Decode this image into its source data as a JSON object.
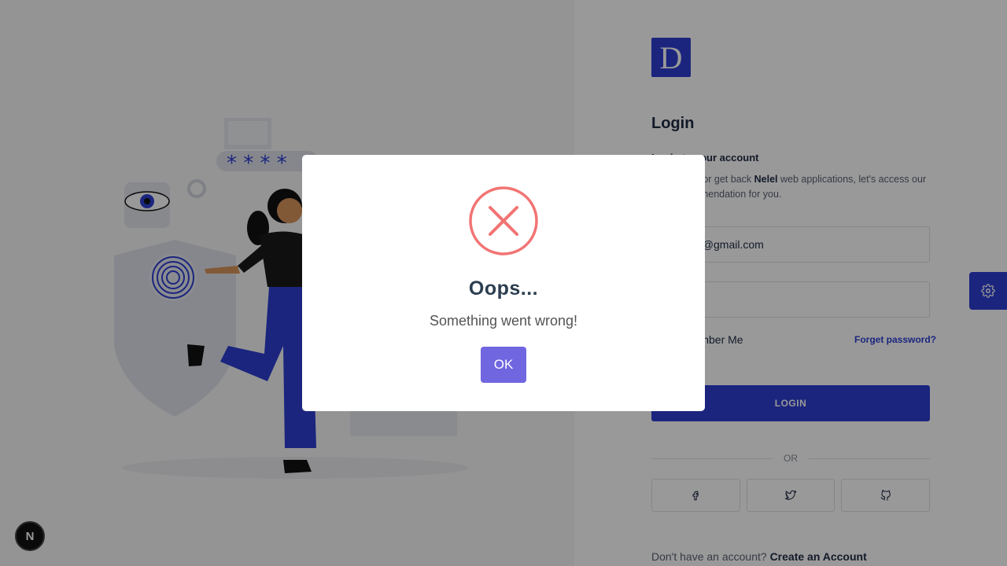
{
  "brand": {
    "logo_letter": "D",
    "accent": "#2d3fd3"
  },
  "login": {
    "title": "Login",
    "subtitle": "Login to your account",
    "desc_prefix": "Thank you for get back ",
    "desc_brand": "Nelel",
    "desc_suffix": " web applications, let's access our best recommendation for you.",
    "email_value": "kbxr203@gmail.com",
    "password_value": "",
    "remember_label": "Remember Me",
    "forget_label": "Forget password?",
    "login_button": "LOGIN",
    "or_label": "OR",
    "social": [
      {
        "icon": "facebook-icon"
      },
      {
        "icon": "twitter-icon"
      },
      {
        "icon": "github-icon"
      }
    ],
    "signup_prefix": "Don't have an account?",
    "signup_link": "Create an Account"
  },
  "settings_tab": {
    "icon": "gear-icon"
  },
  "framework_badge": {
    "letter": "N"
  },
  "dialog": {
    "icon": "error-x-icon",
    "icon_color": "#f27474",
    "title": "Oops...",
    "text": "Something went wrong!",
    "button": "OK",
    "button_color": "#7066e0"
  }
}
